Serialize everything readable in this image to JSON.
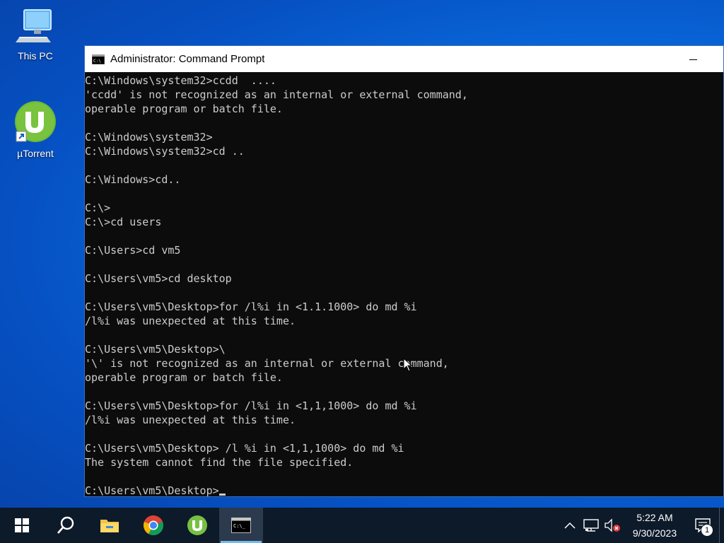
{
  "desktop": {
    "icons": [
      {
        "label": "This PC",
        "icon": "computer-icon"
      },
      {
        "label": "µTorrent",
        "icon": "utorrent-icon"
      }
    ]
  },
  "window": {
    "title": "Administrator: Command Prompt",
    "icon": "cmd-icon",
    "console_lines": [
      "C:\\Windows\\system32>ccdd  ....",
      "'ccdd' is not recognized as an internal or external command,",
      "operable program or batch file.",
      "",
      "C:\\Windows\\system32>",
      "C:\\Windows\\system32>cd ..",
      "",
      "C:\\Windows>cd..",
      "",
      "C:\\>",
      "C:\\>cd users",
      "",
      "C:\\Users>cd vm5",
      "",
      "C:\\Users\\vm5>cd desktop",
      "",
      "C:\\Users\\vm5\\Desktop>for /l%i in <1.1.1000> do md %i",
      "/l%i was unexpected at this time.",
      "",
      "C:\\Users\\vm5\\Desktop>\\",
      "'\\' is not recognized as an internal or external command,",
      "operable program or batch file.",
      "",
      "C:\\Users\\vm5\\Desktop>for /l%i in <1,1,1000> do md %i",
      "/l%i was unexpected at this time.",
      "",
      "C:\\Users\\vm5\\Desktop> /l %i in <1,1,1000> do md %i",
      "The system cannot find the file specified.",
      "",
      "C:\\Users\\vm5\\Desktop>"
    ],
    "console_colors": {
      "background": "#0c0c0c",
      "text": "#cccccc"
    }
  },
  "taskbar": {
    "buttons": [
      {
        "name": "start-button",
        "icon": "windows-logo-icon"
      },
      {
        "name": "search-button",
        "icon": "search-icon"
      },
      {
        "name": "file-explorer-button",
        "icon": "folder-icon"
      },
      {
        "name": "chrome-button",
        "icon": "chrome-icon"
      },
      {
        "name": "utorrent-taskbar-button",
        "icon": "utorrent-icon"
      },
      {
        "name": "cmd-taskbar-button",
        "icon": "cmd-icon"
      }
    ],
    "tray": {
      "icons": [
        "chevron-up-icon",
        "network-icon",
        "volume-muted-icon"
      ],
      "time": "5:22 AM",
      "date": "9/30/2023",
      "notification_count": "1"
    }
  }
}
